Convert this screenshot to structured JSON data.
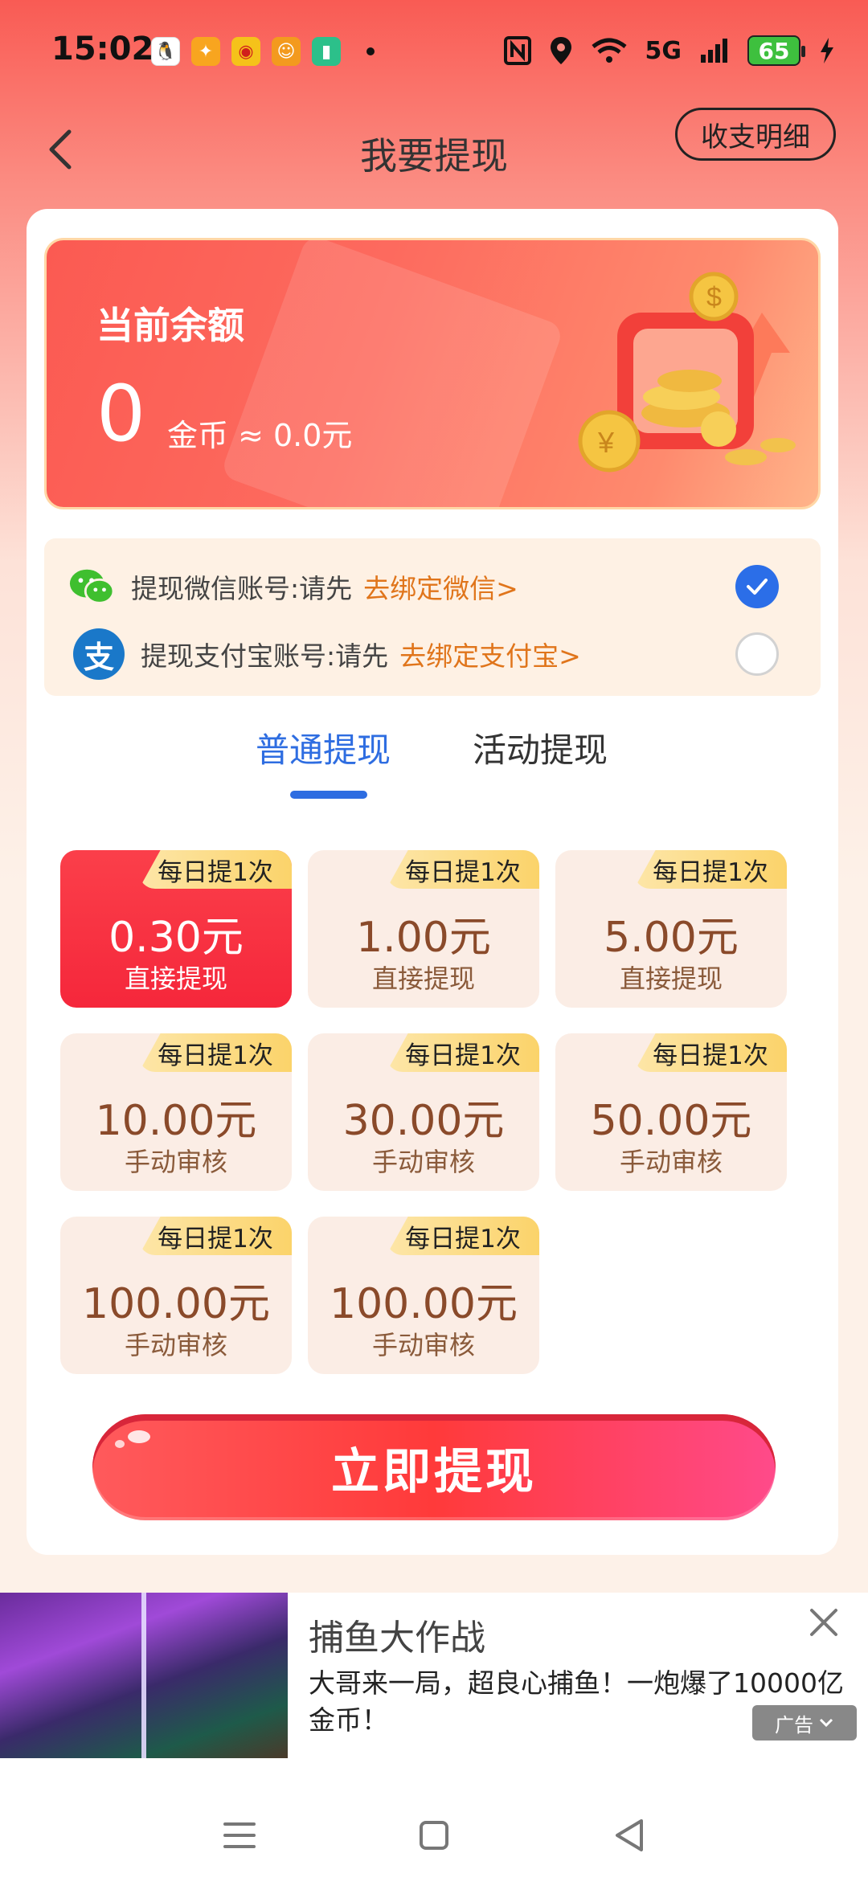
{
  "status_bar": {
    "time": "15:02",
    "battery": "65",
    "network": "5G",
    "app_icons": [
      "qq-icon",
      "app-orange-icon",
      "weibo-icon",
      "app-face-icon",
      "battery-app-icon"
    ]
  },
  "header": {
    "title": "我要提现",
    "ledger_button": "收支明细"
  },
  "balance": {
    "label": "当前余额",
    "amount": "0",
    "unit": "金币 ≈ 0.0元"
  },
  "accounts": {
    "wechat_text": "提现微信账号:请先",
    "wechat_link": "去绑定微信>",
    "wechat_selected": true,
    "alipay_text": "提现支付宝账号:请先",
    "alipay_link": "去绑定支付宝>",
    "alipay_selected": false
  },
  "tabs": {
    "normal": "普通提现",
    "activity": "活动提现",
    "active": "normal"
  },
  "amounts": [
    {
      "tag": "每日提1次",
      "value": "0.30元",
      "sub": "直接提现",
      "selected": true
    },
    {
      "tag": "每日提1次",
      "value": "1.00元",
      "sub": "直接提现",
      "selected": false
    },
    {
      "tag": "每日提1次",
      "value": "5.00元",
      "sub": "直接提现",
      "selected": false
    },
    {
      "tag": "每日提1次",
      "value": "10.00元",
      "sub": "手动审核",
      "selected": false
    },
    {
      "tag": "每日提1次",
      "value": "30.00元",
      "sub": "手动审核",
      "selected": false
    },
    {
      "tag": "每日提1次",
      "value": "50.00元",
      "sub": "手动审核",
      "selected": false
    },
    {
      "tag": "每日提1次",
      "value": "100.00元",
      "sub": "手动审核",
      "selected": false
    },
    {
      "tag": "每日提1次",
      "value": "100.00元",
      "sub": "手动审核",
      "selected": false
    }
  ],
  "withdraw_button": "立即提现",
  "ad": {
    "title": "捕鱼大作战",
    "description": "大哥来一局，超良心捕鱼！一炮爆了10000亿金币！",
    "badge": "广告"
  },
  "colors": {
    "accent_blue": "#2e6de1",
    "brand_red": "#f5273b",
    "link_orange": "#e0751b"
  }
}
